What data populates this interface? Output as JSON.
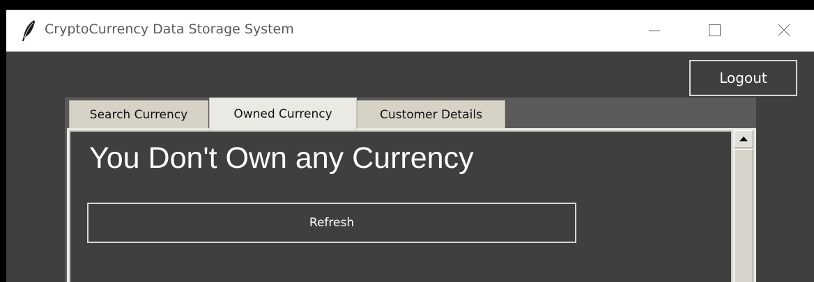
{
  "window": {
    "title": "CryptoCurrency Data Storage System",
    "icon": "feather-icon"
  },
  "header": {
    "logout_label": "Logout"
  },
  "tabs": [
    {
      "label": "Search Currency",
      "selected": false
    },
    {
      "label": "Owned Currency",
      "selected": true
    },
    {
      "label": "Customer Details",
      "selected": false
    }
  ],
  "owned_tab": {
    "heading": "You Don't Own any Currency",
    "refresh_label": "Refresh"
  },
  "colors": {
    "background": "#3f3f3f",
    "tab_selected": "#ebe9e3",
    "tab_unselected": "#d6d2c6",
    "text_light": "#ffffff"
  }
}
